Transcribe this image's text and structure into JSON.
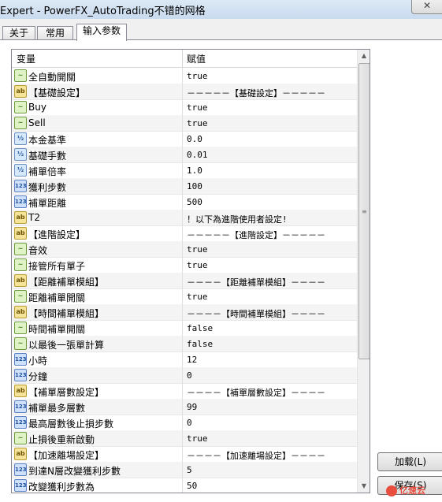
{
  "window": {
    "title": "Expert - PowerFX_AutoTrading不错的网格",
    "close_glyph": "✕"
  },
  "tabs": [
    {
      "label": "关于",
      "active": false
    },
    {
      "label": "常用",
      "active": false
    },
    {
      "label": "输入参数",
      "active": true
    }
  ],
  "grid": {
    "header": {
      "name": "变量",
      "value": "赋值"
    },
    "rows": [
      {
        "type": "bool",
        "icon_text": "~",
        "name": "全自動開關",
        "value": "true"
      },
      {
        "type": "str",
        "icon_text": "ab",
        "name": "【基礎設定】",
        "value": "－－－－－【基礎設定】－－－－－"
      },
      {
        "type": "bool",
        "icon_text": "~",
        "name": "Buy",
        "value": "true"
      },
      {
        "type": "bool",
        "icon_text": "~",
        "name": "Sell",
        "value": "true"
      },
      {
        "type": "dbl",
        "icon_text": "½",
        "name": "本金基準",
        "value": "0.0"
      },
      {
        "type": "dbl",
        "icon_text": "½",
        "name": "基礎手數",
        "value": "0.01"
      },
      {
        "type": "dbl",
        "icon_text": "½",
        "name": "補單倍率",
        "value": "1.0"
      },
      {
        "type": "int",
        "icon_text": "123",
        "name": "獲利步數",
        "value": "100"
      },
      {
        "type": "int",
        "icon_text": "123",
        "name": "補單距離",
        "value": "500"
      },
      {
        "type": "str",
        "icon_text": "ab",
        "name": "T2",
        "value": "！以下為進階使用者設定!"
      },
      {
        "type": "str",
        "icon_text": "ab",
        "name": "【進階設定】",
        "value": "－－－－－【進階設定】－－－－－"
      },
      {
        "type": "bool",
        "icon_text": "~",
        "name": "音效",
        "value": "true"
      },
      {
        "type": "bool",
        "icon_text": "~",
        "name": "接管所有單子",
        "value": "true"
      },
      {
        "type": "str",
        "icon_text": "ab",
        "name": "【距離補單模組】",
        "value": "－－－－【距離補單模組】－－－－"
      },
      {
        "type": "bool",
        "icon_text": "~",
        "name": "距離補單開關",
        "value": "true"
      },
      {
        "type": "str",
        "icon_text": "ab",
        "name": "【時間補單模組】",
        "value": "－－－－【時間補單模組】－－－－"
      },
      {
        "type": "bool",
        "icon_text": "~",
        "name": "時間補單開關",
        "value": "false"
      },
      {
        "type": "bool",
        "icon_text": "~",
        "name": "以最後一張單計算",
        "value": "false"
      },
      {
        "type": "int",
        "icon_text": "123",
        "name": "小時",
        "value": "12"
      },
      {
        "type": "int",
        "icon_text": "123",
        "name": "分鐘",
        "value": "0"
      },
      {
        "type": "str",
        "icon_text": "ab",
        "name": "【補單層數設定】",
        "value": "－－－－【補單層數設定】－－－－"
      },
      {
        "type": "int",
        "icon_text": "123",
        "name": "補單最多層數",
        "value": "99"
      },
      {
        "type": "int",
        "icon_text": "123",
        "name": "最高層數後止損步數",
        "value": "0"
      },
      {
        "type": "bool",
        "icon_text": "~",
        "name": "止損後重新啟動",
        "value": "true"
      },
      {
        "type": "str",
        "icon_text": "ab",
        "name": "【加速離場設定】",
        "value": "－－－－【加速離場設定】－－－－"
      },
      {
        "type": "int",
        "icon_text": "123",
        "name": "到達N層改變獲利步數",
        "value": "5"
      },
      {
        "type": "int",
        "icon_text": "123",
        "name": "改變獲利步數為",
        "value": "50"
      }
    ]
  },
  "scrollbar": {
    "up_glyph": "▲",
    "down_glyph": "▼",
    "grip_glyph": "≡"
  },
  "buttons": {
    "load": "加载(L)",
    "save": "保存(S)"
  },
  "watermark": {
    "text": "亿速云"
  }
}
